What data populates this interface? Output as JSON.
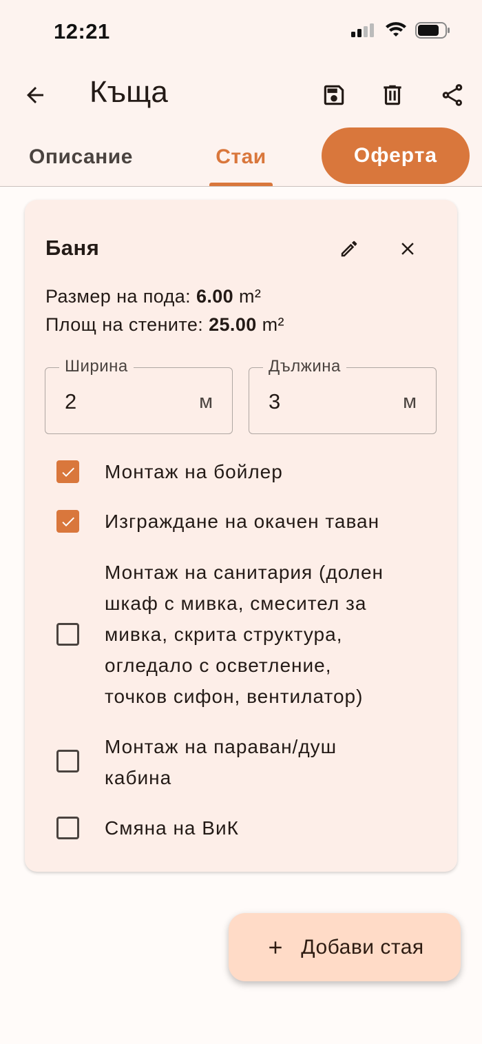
{
  "status_bar": {
    "time": "12:21"
  },
  "appbar": {
    "title": "Къща",
    "icons": [
      "back-arrow-icon",
      "save-icon",
      "delete-icon",
      "share-icon"
    ]
  },
  "tabs": [
    {
      "label": "Описание",
      "selected": false
    },
    {
      "label": "Стаи",
      "selected": true
    },
    {
      "label": "Оферта",
      "selected": false
    }
  ],
  "room_card": {
    "title": "Баня",
    "floor_area_label": "Размер на пода:",
    "floor_area_value": "6.00",
    "floor_area_unit": "m²",
    "wall_area_label": "Площ на стените:",
    "wall_area_value": "25.00",
    "wall_area_unit": "m²",
    "width": {
      "label": "Ширина",
      "value": "2",
      "unit": "м"
    },
    "length": {
      "label": "Дължина",
      "value": "3",
      "unit": "м"
    },
    "options": [
      {
        "lines": [
          "Монтаж на бойлер"
        ],
        "checked": true
      },
      {
        "lines": [
          "Изграждане на окачен таван"
        ],
        "checked": true
      },
      {
        "lines": [
          "Монтаж на санитария (долен",
          "шкаф с мивка, смесител за",
          "мивка, скрита структура,",
          "огледало с осветление,",
          "точков сифон, вентилатор)"
        ],
        "checked": false
      },
      {
        "lines": [
          "Монтаж на параван/душ",
          "кабина"
        ],
        "checked": false
      },
      {
        "lines": [
          "Смяна на ВиК"
        ],
        "checked": false
      }
    ]
  },
  "fab": {
    "label": "Добави стая"
  },
  "colors": {
    "accent": "#d9773c",
    "card_bg": "#fdeee8",
    "fab_bg": "#ffdbc7"
  }
}
